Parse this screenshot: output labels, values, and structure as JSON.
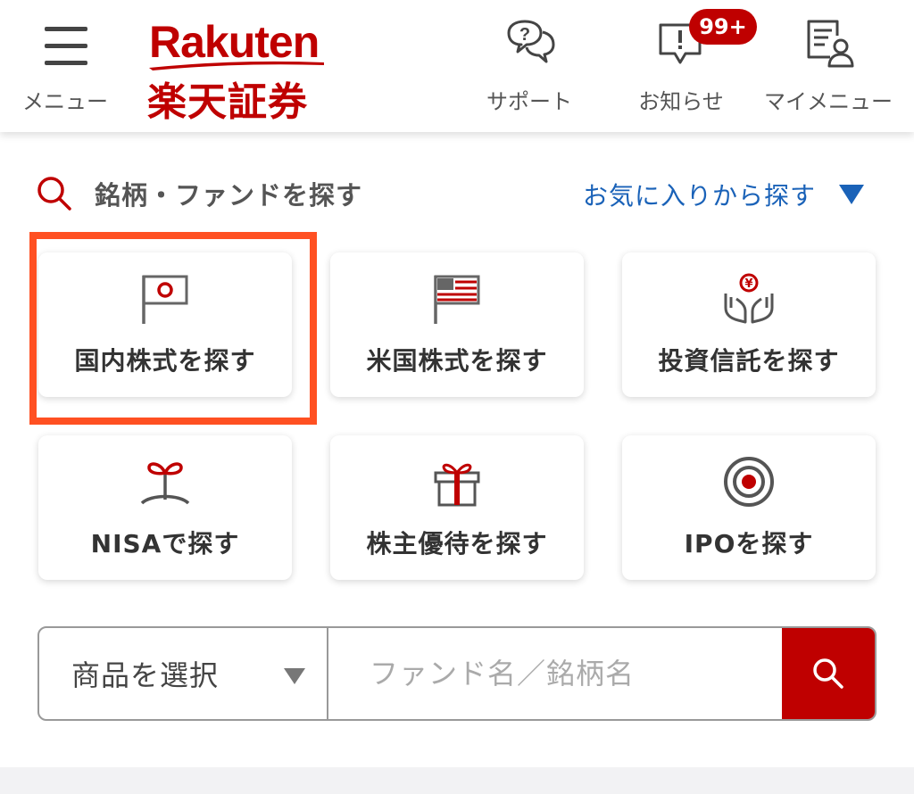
{
  "header": {
    "menu_label": "メニュー",
    "logo_en": "Rakuten",
    "logo_jp": "楽天証券",
    "support_label": "サポート",
    "news_label": "お知らせ",
    "news_badge": "99+",
    "mymenu_label": "マイメニュー"
  },
  "search": {
    "title": "銘柄・ファンドを探す",
    "favorites_link": "お気に入りから探す"
  },
  "categories": [
    {
      "label": "国内株式を探す",
      "icon": "japan-flag-icon"
    },
    {
      "label": "米国株式を探す",
      "icon": "us-flag-icon"
    },
    {
      "label": "投資信託を探す",
      "icon": "hands-yen-icon"
    },
    {
      "label": "NISAで探す",
      "icon": "sprout-icon"
    },
    {
      "label": "株主優待を探す",
      "icon": "gift-icon"
    },
    {
      "label": "IPOを探す",
      "icon": "target-icon"
    }
  ],
  "searchbar": {
    "select_value": "商品を選択",
    "input_placeholder": "ファンド名／銘柄名"
  },
  "colors": {
    "brand": "#bf0000",
    "link": "#1a62b8",
    "highlight": "#ff5022"
  }
}
